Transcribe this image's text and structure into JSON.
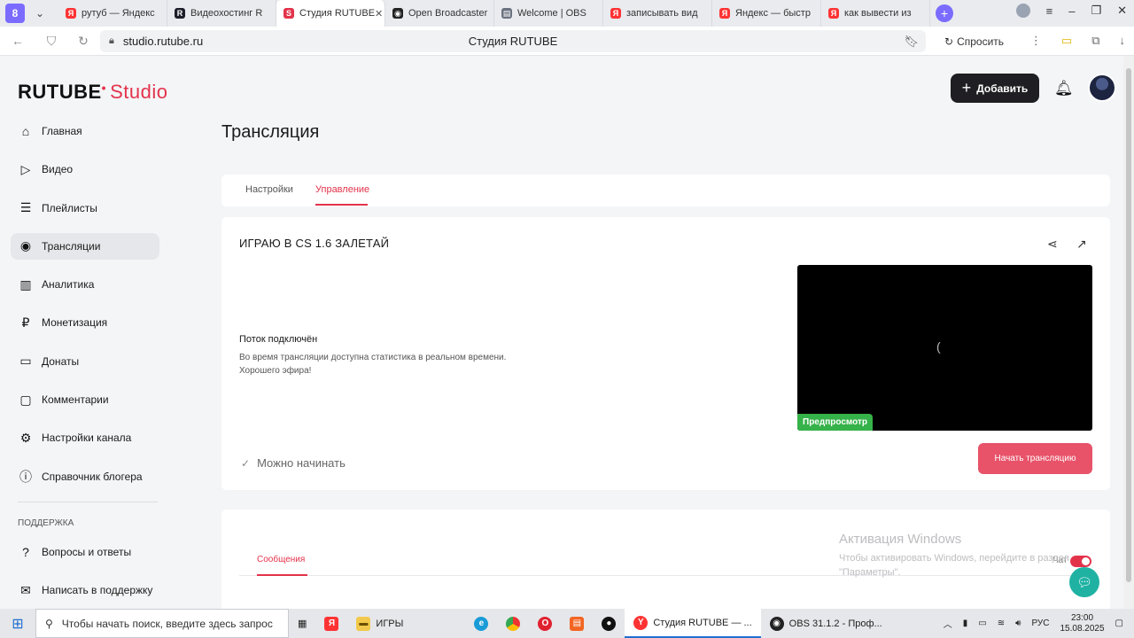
{
  "browser": {
    "logo_badge": "8",
    "tabs": [
      {
        "label": "рутуб — Яндекс",
        "fav": "Я",
        "color": "#f33"
      },
      {
        "label": "Видеохостинг R",
        "fav": "R",
        "color": "#1e1e2a"
      },
      {
        "label": "Студия RUTUBE",
        "fav": "S",
        "color": "#e3334b",
        "active": true
      },
      {
        "label": "Open Broadcaster",
        "fav": "◉",
        "color": "#222"
      },
      {
        "label": "Welcome | OBS",
        "fav": "▤",
        "color": "#6b7280"
      },
      {
        "label": "записывать вид",
        "fav": "Я",
        "color": "#f33"
      },
      {
        "label": "Яндекс — быстр",
        "fav": "Я",
        "color": "#f33"
      },
      {
        "label": "как вывести из",
        "fav": "Я",
        "color": "#f33"
      }
    ],
    "url": "studio.rutube.ru",
    "page_title": "Студия RUTUBE",
    "ask_label": "Спросить"
  },
  "header": {
    "logo_main": "RUTUBE",
    "logo_sub": "Studio",
    "add_label": "Добавить"
  },
  "sidebar": {
    "items": [
      {
        "label": "Главная",
        "icon": "home-icon",
        "glyph": "⌂"
      },
      {
        "label": "Видео",
        "icon": "video-icon",
        "glyph": "▷"
      },
      {
        "label": "Плейлисты",
        "icon": "playlist-icon",
        "glyph": "☰"
      },
      {
        "label": "Трансляции",
        "icon": "broadcast-icon",
        "glyph": "◉",
        "active": true
      },
      {
        "label": "Аналитика",
        "icon": "analytics-icon",
        "glyph": "▥"
      },
      {
        "label": "Монетизация",
        "icon": "money-icon",
        "glyph": "₽"
      },
      {
        "label": "Донаты",
        "icon": "donate-icon",
        "glyph": "▭"
      },
      {
        "label": "Комментарии",
        "icon": "comments-icon",
        "glyph": "▢"
      },
      {
        "label": "Настройки канала",
        "icon": "gear-icon",
        "glyph": "⚙"
      },
      {
        "label": "Справочник блогера",
        "icon": "info-icon",
        "glyph": "ⓘ"
      }
    ],
    "section_label": "ПОДДЕРЖКА",
    "support_items": [
      {
        "label": "Вопросы и ответы",
        "icon": "question-icon",
        "glyph": "?"
      },
      {
        "label": "Написать в поддержку",
        "icon": "mail-icon",
        "glyph": "✉"
      }
    ]
  },
  "main": {
    "title": "Трансляция",
    "tabs": [
      {
        "label": "Настройки"
      },
      {
        "label": "Управление",
        "active": true
      }
    ],
    "stream": {
      "title": "ИГРАЮ В CS 1.6 ЗАЛЕТАЙ",
      "status_head": "Поток подключён",
      "status_line1": "Во время трансляции доступна статистика в реальном времени.",
      "status_line2": "Хорошего эфира!",
      "preview_label": "Предпросмотр",
      "ready_label": "Можно начинать",
      "start_label": "Начать трансляцию"
    },
    "chat": {
      "tab_label": "Сообщения",
      "label": "Чат"
    }
  },
  "overlay": {
    "activation_title": "Активация Windows",
    "activation_line1": "Чтобы активировать Windows, перейдите в раздел",
    "activation_line2": "\"Параметры\"."
  },
  "taskbar": {
    "search_placeholder": "Чтобы начать поиск, введите здесь запрос",
    "folder_label": "ИГРЫ",
    "browser_app_label": "Студия RUTUBE — ...",
    "obs_app_label": "OBS 31.1.2 - Проф...",
    "lang": "РУС",
    "time": "23:00",
    "date": "15.08.2025"
  }
}
